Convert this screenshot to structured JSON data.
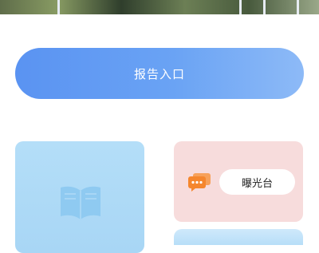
{
  "report_entry": {
    "label": "报告入口"
  },
  "cards": {
    "exposure": {
      "label": "曝光台",
      "icon": "chat-bubble-icon"
    },
    "library": {
      "icon": "book-icon"
    }
  },
  "colors": {
    "report_gradient_start": "#5a93f2",
    "report_gradient_end": "#8dbaf7",
    "library_card": "#b4def8",
    "exposure_card": "#f7dcdc",
    "chat_icon": "#f5862d"
  }
}
